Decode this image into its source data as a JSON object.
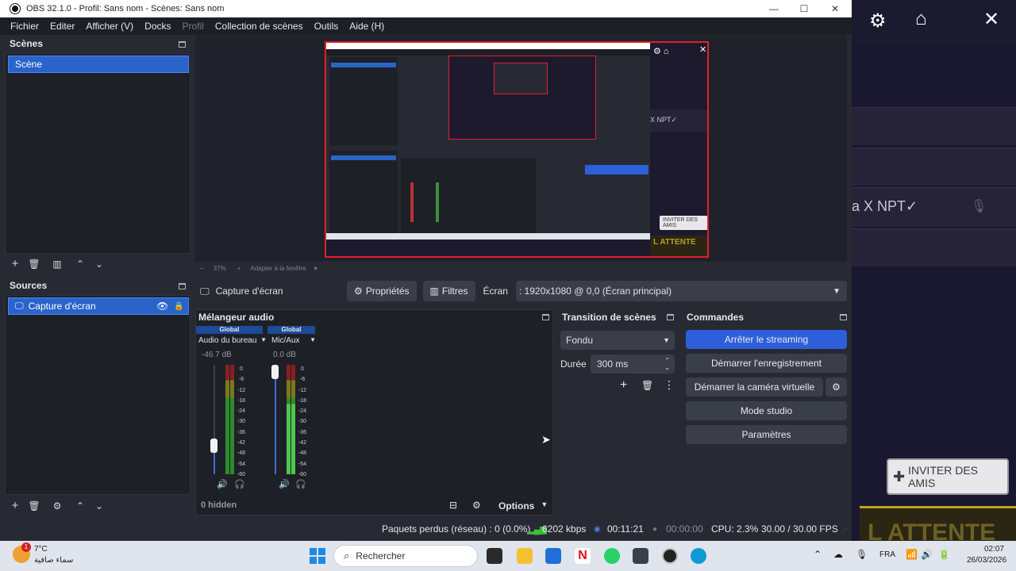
{
  "window": {
    "title": "OBS 32.1.0 - Profil: Sans nom - Scènes: Sans nom",
    "minimize": "—",
    "maximize": "☐",
    "close": "✕"
  },
  "menu": [
    "Fichier",
    "Editer",
    "Afficher (V)",
    "Docks",
    "Profil",
    "Collection de scènes",
    "Outils",
    "Aide (H)"
  ],
  "scenes": {
    "title": "Scènes",
    "items": [
      "Scène"
    ]
  },
  "sources": {
    "title": "Sources",
    "items": [
      {
        "label": "Capture d'écran",
        "visible": true,
        "locked": false
      }
    ]
  },
  "preview": {
    "zoom": "37%",
    "fit_label": "Adapter à la fenêtre",
    "capture_text": {
      "name": "X NPT✓",
      "invite": "INVITER DES AMIS",
      "attente": "L ATTENTE"
    }
  },
  "source_toolbar": {
    "source_name": "Capture d'écran",
    "properties": "Propriétés",
    "filters": "Filtres",
    "screen_label": "Écran",
    "screen_value": ": 1920x1080 @ 0,0 (Écran principal)"
  },
  "mixer": {
    "title": "Mélangeur audio",
    "channels": [
      {
        "header": "Global",
        "name": "Audio du bureau",
        "db": "-46.7 dB",
        "volume_pct": 20,
        "level_pct": 88
      },
      {
        "header": "Global",
        "name": "Mic/Aux",
        "db": "0.0 dB",
        "volume_pct": 100,
        "level_pct": 72
      }
    ],
    "scale": [
      "0",
      "-6",
      "-12",
      "-18",
      "-24",
      "-30",
      "-36",
      "-42",
      "-48",
      "-54",
      "-60"
    ],
    "hidden_count": "0 hidden",
    "options": "Options"
  },
  "transitions": {
    "title": "Transition de scènes",
    "type": "Fondu",
    "duration_label": "Durée",
    "duration_value": "300 ms"
  },
  "commands": {
    "title": "Commandes",
    "buttons": [
      "Arrêter le streaming",
      "Démarrer l'enregistrement",
      "Démarrer la caméra virtuelle",
      "Mode studio",
      "Paramètres"
    ]
  },
  "status": {
    "dropped": "Paquets perdus (réseau) : 0 (0.0%)",
    "bitrate": "6202 kbps",
    "stream_time": "00:11:21",
    "rec_time": "00:00:00",
    "cpu": "CPU: 2.3%",
    "fps": "30.00 / 30.00 FPS"
  },
  "background_app": {
    "name": "a X NPT✓",
    "invite": "INVITER DES AMIS",
    "attente": "L ATTENTE"
  },
  "taskbar": {
    "weather_temp": "7°C",
    "weather_desc": "سماء صافية",
    "weather_badge": "1",
    "search_placeholder": "Rechercher",
    "language": "FRA",
    "time": "02:07",
    "date": "26/03/2026"
  },
  "colors": {
    "accent": "#2a63c9",
    "streaming_button": "#2d5fdb",
    "preview_border": "#e51d2e"
  }
}
